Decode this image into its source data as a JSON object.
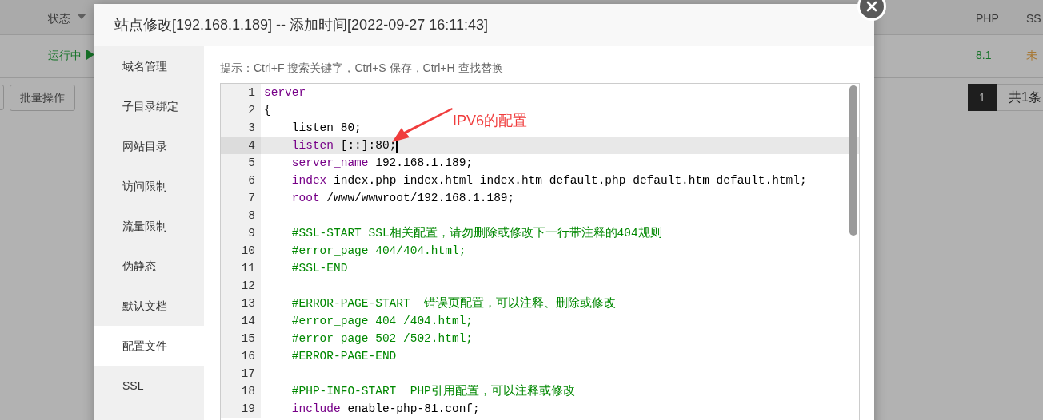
{
  "background_page": {
    "table_header": {
      "status": "状态",
      "php": "PHP",
      "ssl": "SS"
    },
    "row": {
      "status": "运行中",
      "php": "8.1",
      "ssl": "未"
    },
    "toolbar": {
      "batch_button": "批量操作"
    },
    "pagination": {
      "pages": [
        {
          "label": "1",
          "selected": true
        }
      ],
      "total": "共1条"
    }
  },
  "modal": {
    "title": "站点修改[192.168.1.189] -- 添加时间[2022-09-27 16:11:43]",
    "tabs": [
      {
        "label": "域名管理",
        "selected": false
      },
      {
        "label": "子目录绑定",
        "selected": false
      },
      {
        "label": "网站目录",
        "selected": false
      },
      {
        "label": "访问限制",
        "selected": false
      },
      {
        "label": "流量限制",
        "selected": false
      },
      {
        "label": "伪静态",
        "selected": false
      },
      {
        "label": "默认文档",
        "selected": false
      },
      {
        "label": "配置文件",
        "selected": true
      },
      {
        "label": "SSL",
        "selected": false
      }
    ],
    "hint": "提示：Ctrl+F 搜索关键字，Ctrl+S 保存，Ctrl+H 查找替换",
    "editor": {
      "lines": [
        {
          "number": "1",
          "indented": false,
          "selected": false,
          "tokens": [
            {
              "text": "server",
              "kind": "keyword"
            }
          ]
        },
        {
          "number": "2",
          "indented": false,
          "selected": false,
          "tokens": [
            {
              "text": "{",
              "kind": "plain"
            }
          ]
        },
        {
          "number": "3",
          "indented": true,
          "selected": false,
          "tokens": [
            {
              "text": "listen 80;",
              "kind": "plain"
            }
          ]
        },
        {
          "number": "4",
          "indented": true,
          "selected": true,
          "tokens": [
            {
              "text": "listen",
              "kind": "keyword"
            },
            {
              "text": " [::]:80;",
              "kind": "plain"
            }
          ]
        },
        {
          "number": "5",
          "indented": true,
          "selected": false,
          "tokens": [
            {
              "text": "server_name",
              "kind": "keyword"
            },
            {
              "text": " 192.168.1.189;",
              "kind": "plain"
            }
          ]
        },
        {
          "number": "6",
          "indented": true,
          "selected": false,
          "tokens": [
            {
              "text": "index",
              "kind": "keyword"
            },
            {
              "text": " index.php index.html index.htm default.php default.htm default.html;",
              "kind": "plain"
            }
          ]
        },
        {
          "number": "7",
          "indented": true,
          "selected": false,
          "tokens": [
            {
              "text": "root",
              "kind": "keyword"
            },
            {
              "text": " /www/wwwroot/192.168.1.189;",
              "kind": "plain"
            }
          ]
        },
        {
          "number": "8",
          "indented": false,
          "selected": false
        },
        {
          "number": "9",
          "indented": true,
          "selected": false,
          "tokens": [
            {
              "text": "#SSL-START SSL相关配置，请勿删除或修改下一行带注释的404规则",
              "kind": "comment"
            }
          ]
        },
        {
          "number": "10",
          "indented": true,
          "selected": false,
          "tokens": [
            {
              "text": "#error_page 404/404.html;",
              "kind": "comment"
            }
          ]
        },
        {
          "number": "11",
          "indented": true,
          "selected": false,
          "tokens": [
            {
              "text": "#SSL-END",
              "kind": "comment"
            }
          ]
        },
        {
          "number": "12",
          "indented": false,
          "selected": false
        },
        {
          "number": "13",
          "indented": true,
          "selected": false,
          "tokens": [
            {
              "text": "#ERROR-PAGE-START  错误页配置，可以注释、删除或修改",
              "kind": "comment"
            }
          ]
        },
        {
          "number": "14",
          "indented": true,
          "selected": false,
          "tokens": [
            {
              "text": "#error_page 404 /404.html;",
              "kind": "comment"
            }
          ]
        },
        {
          "number": "15",
          "indented": true,
          "selected": false,
          "tokens": [
            {
              "text": "#error_page 502 /502.html;",
              "kind": "comment"
            }
          ]
        },
        {
          "number": "16",
          "indented": true,
          "selected": false,
          "tokens": [
            {
              "text": "#ERROR-PAGE-END",
              "kind": "comment"
            }
          ]
        },
        {
          "number": "17",
          "indented": false,
          "selected": false
        },
        {
          "number": "18",
          "indented": true,
          "selected": false,
          "tokens": [
            {
              "text": "#PHP-INFO-START  PHP引用配置，可以注释或修改",
              "kind": "comment"
            }
          ]
        },
        {
          "number": "19",
          "indented": true,
          "selected": false,
          "tokens": [
            {
              "text": "include",
              "kind": "keyword"
            },
            {
              "text": " enable-php-81.conf;",
              "kind": "plain"
            }
          ]
        }
      ]
    }
  },
  "annotation": {
    "text": "IPV6的配置"
  }
}
